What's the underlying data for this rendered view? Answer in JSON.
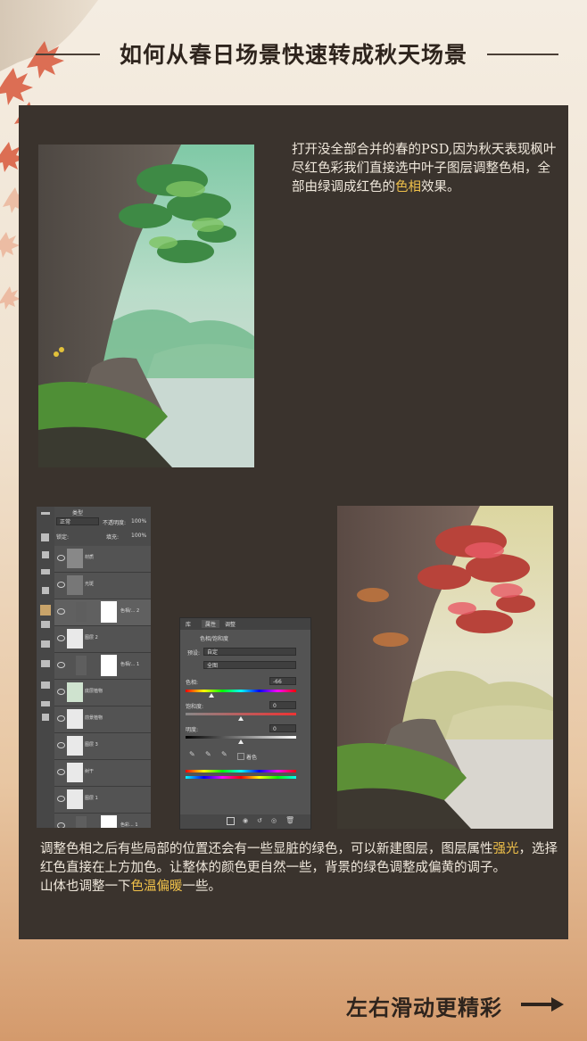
{
  "title": "如何从春日场景快速转成秋天场景",
  "intro": {
    "part1": "打开没全部合并的春的PSD,因为秋天表现枫叶尽红色彩我们直接选中叶子图层调整色相，全部由绿调成红色的",
    "highlight": "色相",
    "part2": "效果。"
  },
  "body": {
    "p1_part1": "调整色相之后有些局部的位置还会有一些显脏的绿色，可以新建图层，图层属性",
    "p1_highlight": "强光",
    "p1_part2": "，选择红色直接在上方加色。让整体的颜色更自然一些，背景的绿色调整成偏黄的调子。",
    "p2_part1": "山体也调整一下",
    "p2_highlight": "色温偏暖",
    "p2_part2": "一些。"
  },
  "layers_panel": {
    "kind_label": "类型",
    "mode": "正常",
    "opacity_label": "不透明度:",
    "opacity": "100%",
    "lock_label": "锁定:",
    "fill_label": "填充:",
    "fill": "100%",
    "layers": [
      "材质",
      "光斑",
      "色相/... 2",
      "图层 2",
      "色相/... 1",
      "底层植物",
      "前景植物",
      "图层 3",
      "树干",
      "图层 1",
      "色彩... 1"
    ]
  },
  "properties_panel": {
    "tabs": [
      "库",
      "属性",
      "调整"
    ],
    "title": "色相/饱和度",
    "preset_label": "预设:",
    "preset_value": "自定",
    "channel_value": "全图",
    "hue_label": "色相:",
    "hue_value": "-66",
    "saturation_label": "饱和度:",
    "saturation_value": "0",
    "lightness_label": "明度:",
    "lightness_value": "0",
    "colorize_label": "着色"
  },
  "footer": {
    "text": "左右滑动更精彩"
  },
  "colors": {
    "highlight": "#f0c14a",
    "panel_bg": "#3a332d",
    "text_light": "#f0e8dc",
    "title_dark": "#2e241d"
  },
  "icons": [
    "right-arrow-icon",
    "eye-icon",
    "link-icon",
    "trash-icon",
    "new-layer-icon",
    "eyedropper-icon"
  ]
}
